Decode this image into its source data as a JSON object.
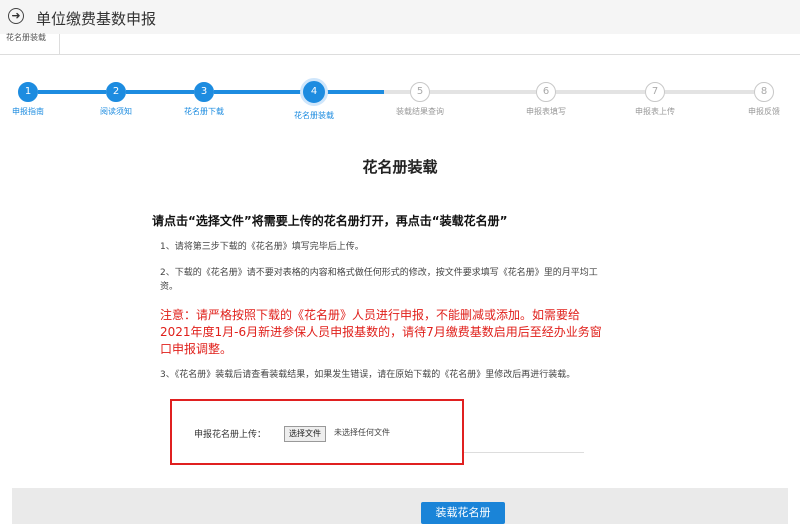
{
  "header": {
    "title": "单位缴费基数申报",
    "back_icon": "arrow-circle-left-icon"
  },
  "tabs": [
    {
      "label": "花名册装载"
    }
  ],
  "stepper": {
    "current": 4,
    "active_color": "#1d8ce0",
    "pending_color": "#c8c8c8",
    "steps": [
      {
        "number": "1",
        "label": "申报指南",
        "state": "done"
      },
      {
        "number": "2",
        "label": "阅读须知",
        "state": "done"
      },
      {
        "number": "3",
        "label": "花名册下载",
        "state": "done"
      },
      {
        "number": "4",
        "label": "花名册装载",
        "state": "active"
      },
      {
        "number": "5",
        "label": "装载结果查询",
        "state": "pending"
      },
      {
        "number": "6",
        "label": "申报表填写",
        "state": "pending"
      },
      {
        "number": "7",
        "label": "申报表上传",
        "state": "pending"
      },
      {
        "number": "8",
        "label": "申报反馈",
        "state": "pending"
      }
    ]
  },
  "main": {
    "section_title": "花名册装载",
    "instruction": "请点击“选择文件”将需要上传的花名册打开，再点击“装载花名册”",
    "notes": [
      "1、请将第三步下载的《花名册》填写完毕后上传。",
      "2、下载的《花名册》请不要对表格的内容和格式做任何形式的修改，按文件要求填写《花名册》里的月平均工资。",
      "3、《花名册》装载后请查看装载结果，如果发生错误，请在原始下载的《花名册》里修改后再进行装载。"
    ],
    "warning": "注意：请严格按照下载的《花名册》人员进行申报，不能删减或添加。如需要给2021年度1月-6月新进参保人员申报基数的，请待7月缴费基数启用后至经办业务窗口申报调整。",
    "warning_color": "#e0201b"
  },
  "upload": {
    "label": "申报花名册上传：",
    "choose_button": "选择文件",
    "file_status": "未选择任何文件",
    "highlight_color": "#e02020"
  },
  "footer": {
    "submit_label": "装载花名册",
    "button_color": "#1a84d8"
  }
}
